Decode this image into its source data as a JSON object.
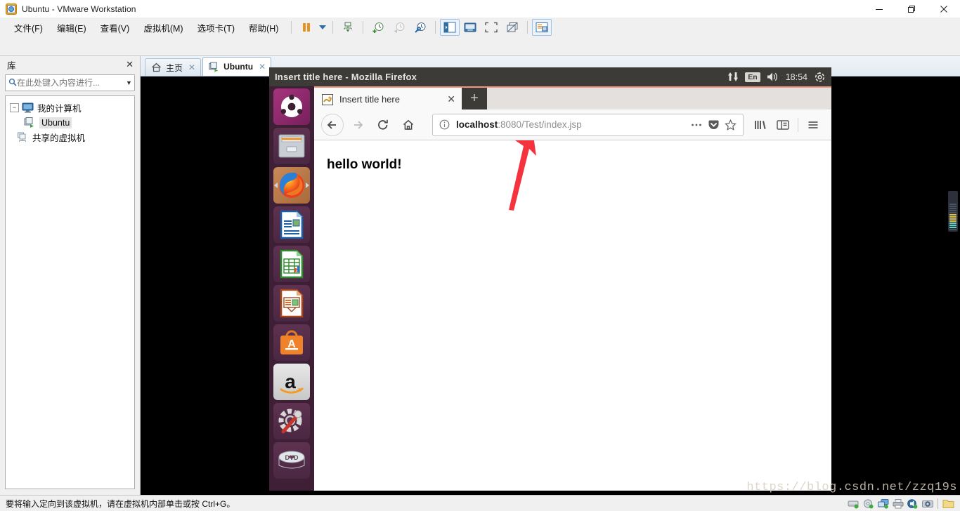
{
  "window": {
    "title": "Ubuntu - VMware Workstation",
    "title_icon": "vmware-ubuntu-icon",
    "controls": {
      "minimize": "—",
      "restore": "❐",
      "close": "✕"
    }
  },
  "menubar": {
    "items": [
      {
        "label": "文件(F)",
        "accel": "F",
        "name": "menu-file"
      },
      {
        "label": "编辑(E)",
        "accel": "E",
        "name": "menu-edit"
      },
      {
        "label": "查看(V)",
        "accel": "V",
        "name": "menu-view"
      },
      {
        "label": "虚拟机(M)",
        "accel": "M",
        "name": "menu-vm"
      },
      {
        "label": "选项卡(T)",
        "accel": "T",
        "name": "menu-tabs"
      },
      {
        "label": "帮助(H)",
        "accel": "H",
        "name": "menu-help"
      }
    ]
  },
  "toolbar": {
    "buttons": [
      {
        "name": "suspend-button",
        "icon": "pause-icon"
      },
      {
        "name": "power-dropdown",
        "icon": "chevron-down-icon"
      },
      {
        "name": "send-ctrl-alt-del-button",
        "icon": "network-share-icon"
      },
      {
        "name": "take-snapshot-button",
        "icon": "snapshot-add-icon"
      },
      {
        "name": "revert-snapshot-button",
        "icon": "snapshot-revert-icon"
      },
      {
        "name": "snapshot-manager-button",
        "icon": "snapshot-manage-icon"
      },
      {
        "name": "show-library-button",
        "icon": "sidebar-panel-icon"
      },
      {
        "name": "show-thumbnail-bar-button",
        "icon": "thumbnail-bar-icon"
      },
      {
        "name": "fullscreen-button",
        "icon": "fullscreen-icon"
      },
      {
        "name": "unity-mode-button",
        "icon": "unity-mode-icon"
      },
      {
        "name": "console-view-button",
        "icon": "console-view-icon"
      }
    ]
  },
  "library": {
    "title": "库",
    "close_label": "✕",
    "search": {
      "placeholder": "在此处键入内容进行...",
      "value": "",
      "icon": "search-icon",
      "caret": "▼"
    },
    "tree": [
      {
        "label": "我的计算机",
        "icon": "computer-icon",
        "expander": "−",
        "selected": false,
        "level": 0,
        "name": "tree-item-my-computer"
      },
      {
        "label": "Ubuntu",
        "icon": "vm-running-icon",
        "expander": "",
        "selected": true,
        "level": 1,
        "name": "tree-item-ubuntu"
      },
      {
        "label": "共享的虚拟机",
        "icon": "shared-vm-icon",
        "expander": "",
        "selected": false,
        "level": 0,
        "name": "tree-item-shared-vms"
      }
    ]
  },
  "vm_tabs": [
    {
      "label": "主页",
      "icon": "home-icon",
      "active": false,
      "close": "✕",
      "name": "vm-tab-home"
    },
    {
      "label": "Ubuntu",
      "icon": "vm-running-icon",
      "active": true,
      "close": "✕",
      "name": "vm-tab-ubuntu"
    }
  ],
  "statusbar": {
    "message": "要将输入定向到该虚拟机，请在虚拟机内部单击或按 Ctrl+G。",
    "devices": [
      {
        "name": "hard-disk-icon"
      },
      {
        "name": "cd-dvd-icon"
      },
      {
        "name": "network-adapter-icon"
      },
      {
        "name": "printer-icon"
      },
      {
        "name": "sound-card-icon"
      },
      {
        "name": "camera-icon"
      },
      {
        "name": "folder-shared-icon"
      }
    ]
  },
  "guest": {
    "titlebar": {
      "title": "Insert title here - Mozilla Firefox",
      "tray": {
        "network_icon": "network-updown-icon",
        "keyboard_layout": "En",
        "volume_icon": "volume-icon",
        "clock": "18:54",
        "gear_icon": "gear-icon"
      }
    },
    "launcher": [
      {
        "name": "launcher-ubuntu-dash",
        "icon": "ubuntu-logo-icon",
        "active": false
      },
      {
        "name": "launcher-files",
        "icon": "files-cabinet-icon",
        "active": false
      },
      {
        "name": "launcher-firefox",
        "icon": "firefox-icon",
        "active": true
      },
      {
        "name": "launcher-libreoffice-writer",
        "icon": "writer-document-icon",
        "active": false
      },
      {
        "name": "launcher-libreoffice-calc",
        "icon": "calc-spreadsheet-icon",
        "active": false
      },
      {
        "name": "launcher-libreoffice-impress",
        "icon": "impress-presentation-icon",
        "active": false
      },
      {
        "name": "launcher-ubuntu-software",
        "icon": "software-bag-icon",
        "active": false
      },
      {
        "name": "launcher-amazon",
        "icon": "amazon-icon",
        "active": false
      },
      {
        "name": "launcher-system-settings",
        "icon": "gear-wrench-icon",
        "active": false
      },
      {
        "name": "launcher-dvd-drive",
        "icon": "dvd-disc-icon",
        "active": false
      }
    ],
    "firefox": {
      "tab": {
        "title": "Insert title here",
        "favicon": "page-favicon",
        "close": "✕"
      },
      "new_tab_label": "+",
      "nav": {
        "back": "←",
        "forward": "→",
        "reload": "⟳",
        "home": "⌂"
      },
      "url": {
        "info_icon": "page-info-icon",
        "host": "localhost",
        "path": ":8080/Test/index.jsp",
        "full": "localhost:8080/Test/index.jsp",
        "page_actions_icon": "ellipsis-icon",
        "pocket_icon": "pocket-icon",
        "bookmark_icon": "star-icon"
      },
      "right_buttons": [
        {
          "name": "library-button",
          "icon": "library-books-icon"
        },
        {
          "name": "sidebar-toggle-button",
          "icon": "sidebar-icon"
        },
        {
          "name": "app-menu-button",
          "icon": "hamburger-icon"
        }
      ],
      "page": {
        "heading": "hello world!"
      }
    },
    "annotation": {
      "name": "red-arrow-annotation",
      "color": "#f5333f"
    }
  },
  "watermark": "https://blog.csdn.net/zzq19s",
  "colors": {
    "ubuntu_purple": "#3e1f35",
    "ubuntu_titlebar": "#3c3b37",
    "firefox_orange": "#f0997a",
    "annotation_red": "#f5333f",
    "vmware_chrome": "#f0f0f0"
  }
}
